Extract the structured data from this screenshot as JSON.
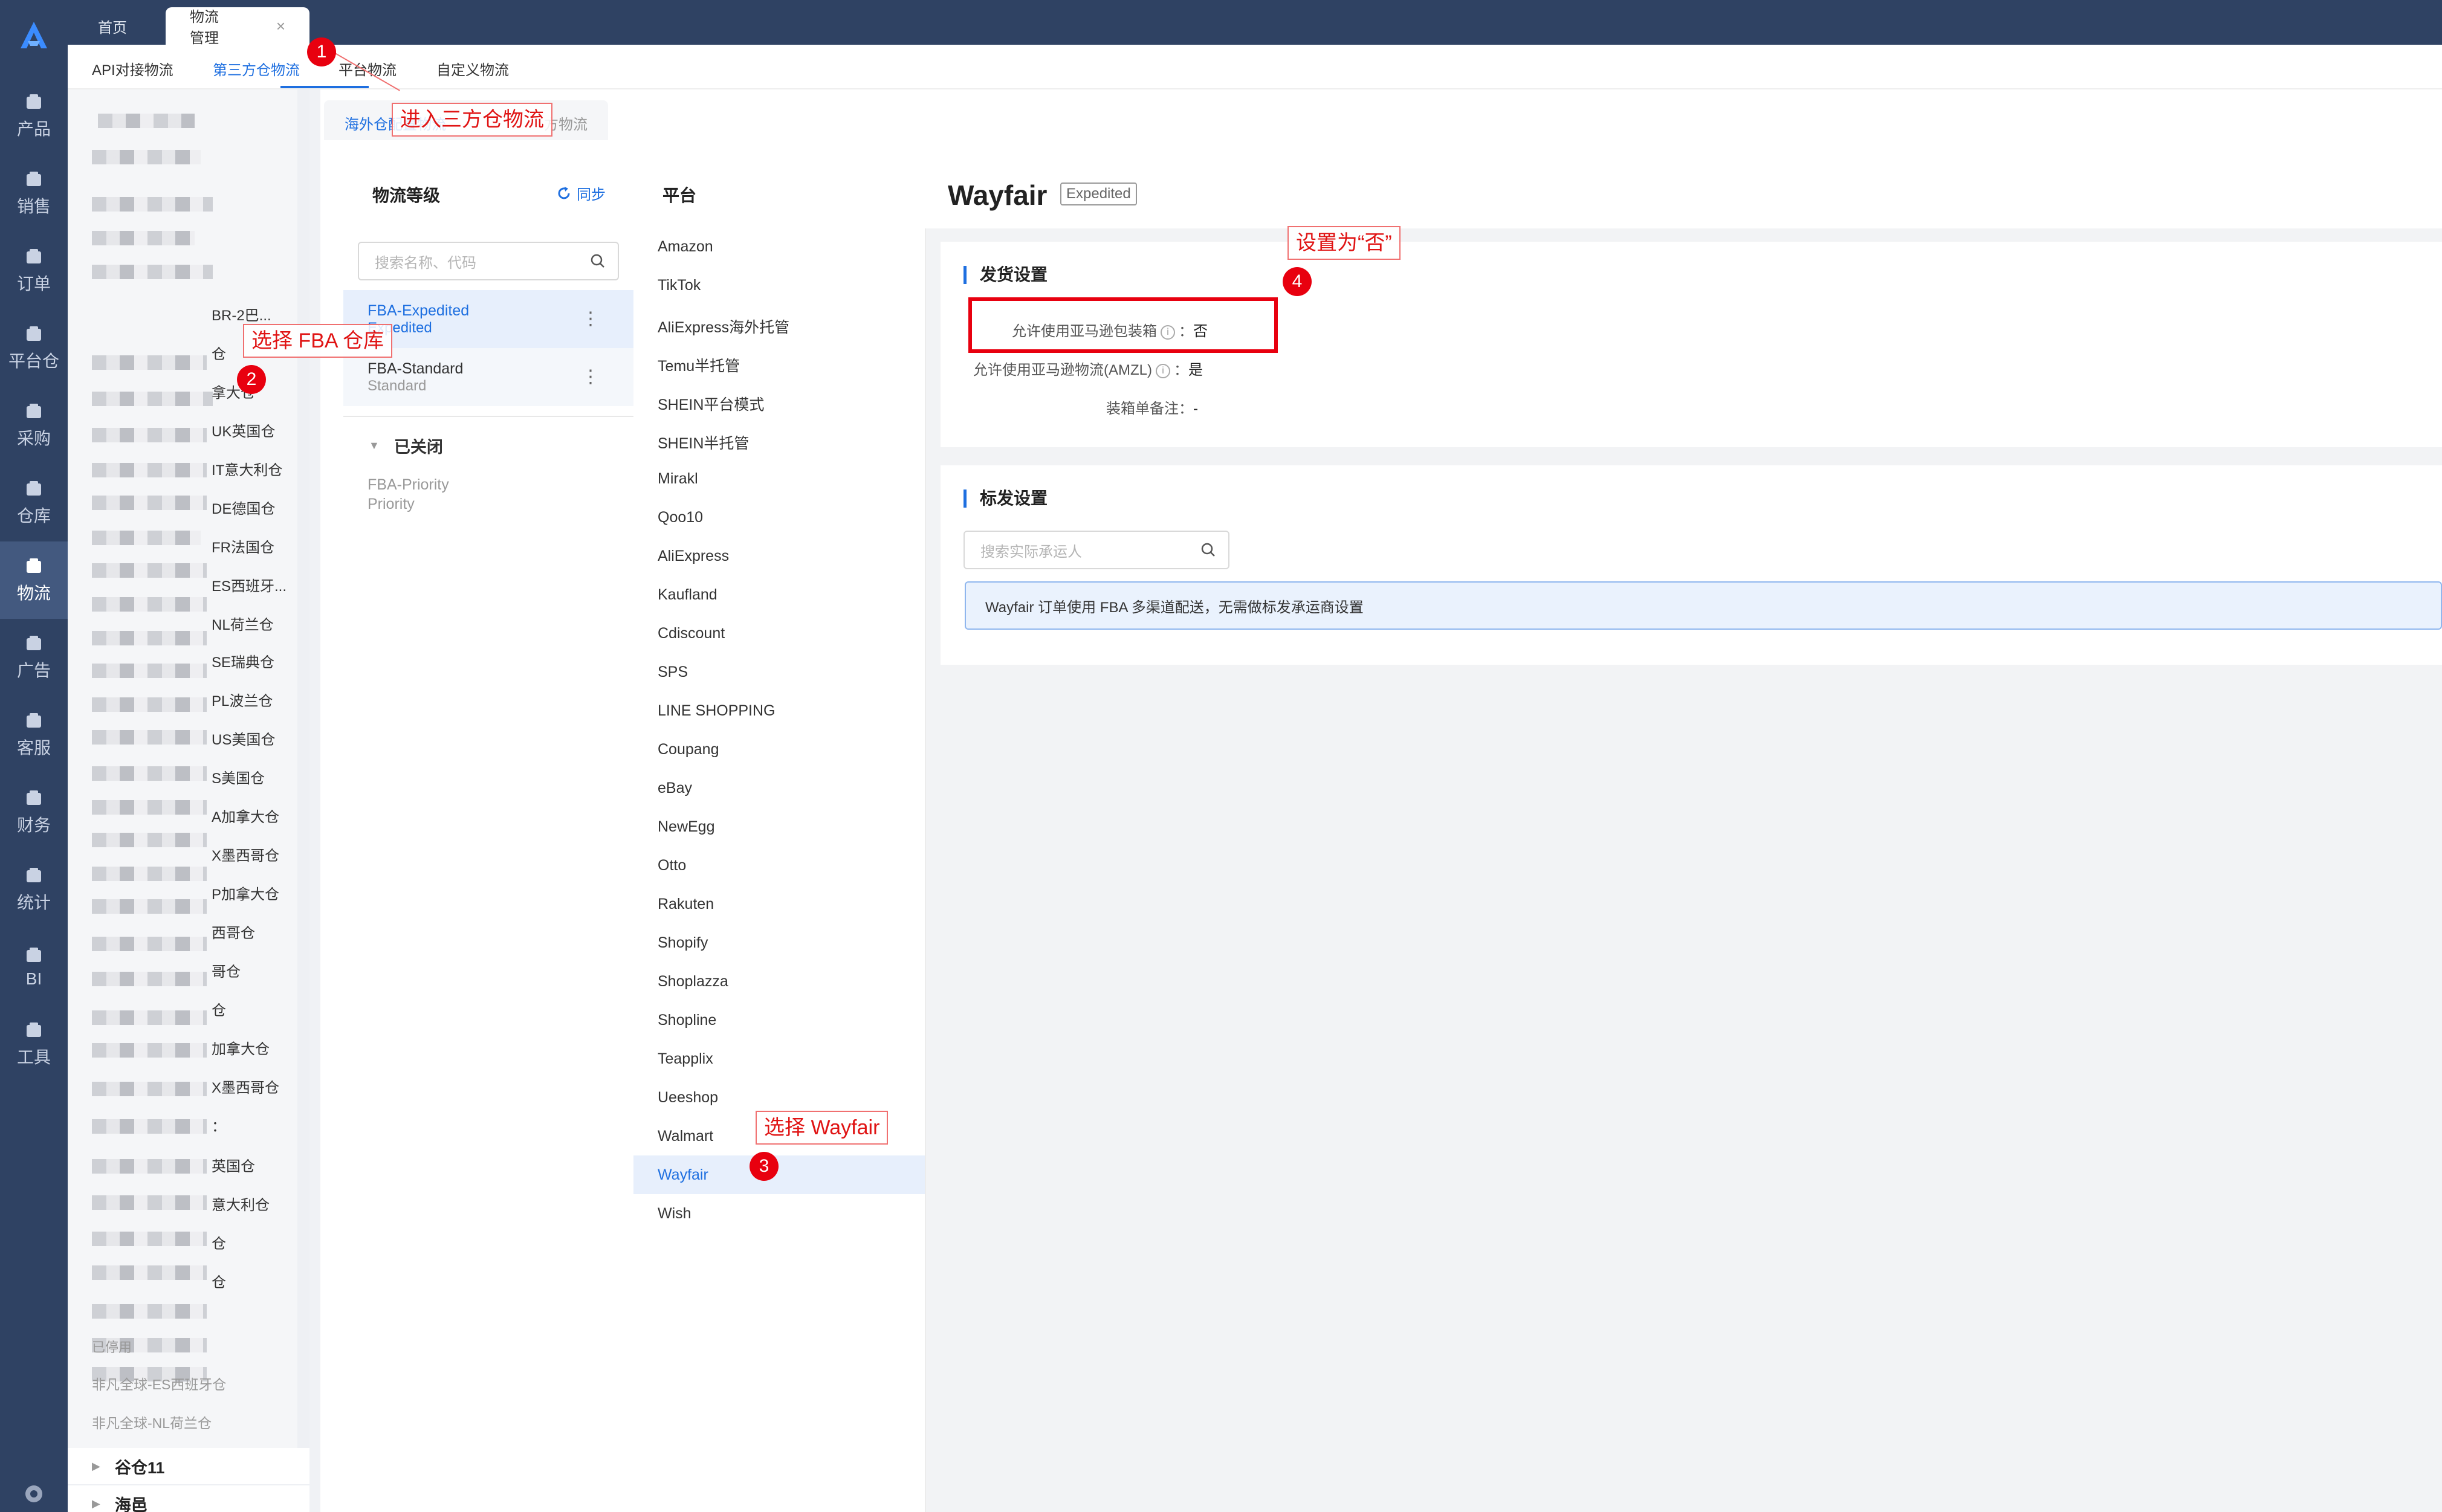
{
  "nav": {
    "items": [
      {
        "label": "产品",
        "icon": "box-icon"
      },
      {
        "label": "销售",
        "icon": "shop-icon"
      },
      {
        "label": "订单",
        "icon": "order-icon"
      },
      {
        "label": "平台仓",
        "icon": "warehouse-icon"
      },
      {
        "label": "采购",
        "icon": "cart-icon"
      },
      {
        "label": "仓库",
        "icon": "store-icon"
      },
      {
        "label": "物流",
        "icon": "truck-icon"
      },
      {
        "label": "广告",
        "icon": "ad-icon"
      },
      {
        "label": "客服",
        "icon": "mail-icon"
      },
      {
        "label": "财务",
        "icon": "yen-icon"
      },
      {
        "label": "统计",
        "icon": "pie-icon"
      },
      {
        "label": "BI",
        "icon": "bi-icon"
      },
      {
        "label": "工具",
        "icon": "wrench-icon"
      }
    ],
    "active_index": 6
  },
  "topbar": {
    "tabs": [
      "首页",
      "物流管理"
    ],
    "close_glyph": "×"
  },
  "subtabs": [
    "API对接物流",
    "第三方仓物流",
    "平台物流",
    "自定义物流"
  ],
  "warehouse_list": {
    "visible_labels": [
      "BR-2巴...",
      "仓",
      "拿大仓",
      "UK英国仓",
      "IT意大利仓",
      "DE德国仓",
      "FR法国仓",
      "ES西班牙...",
      "NL荷兰仓",
      "SE瑞典仓",
      "PL波兰仓",
      "US美国仓",
      "S美国仓",
      "A加拿大仓",
      "X墨西哥仓",
      "P加拿大仓",
      "西哥仓",
      "哥仓",
      "仓",
      "加拿大仓",
      "X墨西哥仓",
      "：",
      "英国仓",
      "意大利仓",
      "仓",
      "仓"
    ],
    "disabled_header": "已停用",
    "disabled_items": [
      "非凡全球-ES西班牙仓",
      "非凡全球-NL荷兰仓"
    ],
    "groups": [
      "谷仓11",
      "海邑"
    ]
  },
  "inner_tabs": [
    "海外仓配置物流",
    "方物流"
  ],
  "levels": {
    "header": "物流等级",
    "sync_label": "同步",
    "search_placeholder": "搜索名称、代码",
    "items": [
      {
        "name": "FBA-Expedited",
        "code": "Expedited"
      },
      {
        "name": "FBA-Standard",
        "code": "Standard"
      }
    ],
    "more_glyph": "⋮",
    "closed_header": "已关闭",
    "closed_items": [
      {
        "name": "FBA-Priority",
        "code": "Priority"
      }
    ]
  },
  "platforms": {
    "header": "平台",
    "items": [
      "Amazon",
      "TikTok",
      "AliExpress海外托管",
      "Temu半托管",
      "SHEIN平台模式",
      "SHEIN半托管",
      "Mirakl",
      "Qoo10",
      "AliExpress",
      "Kaufland",
      "Cdiscount",
      "SPS",
      "LINE SHOPPING",
      "Coupang",
      "eBay",
      "NewEgg",
      "Otto",
      "Rakuten",
      "Shopify",
      "Shoplazza",
      "Shopline",
      "Teapplix",
      "Ueeshop",
      "Walmart",
      "Wayfair",
      "Wish"
    ],
    "selected": "Wayfair"
  },
  "detail": {
    "title": "Wayfair",
    "badge": "Expedited",
    "shipping": {
      "title": "发货设置",
      "rows": [
        {
          "label": "允许使用亚马逊包装箱",
          "value": "否"
        },
        {
          "label": "允许使用亚马逊物流(AMZL)",
          "value": "是"
        },
        {
          "label": "装箱单备注",
          "value": "-"
        }
      ],
      "info_glyph": "i",
      "sep": "："
    },
    "marking": {
      "title": "标发设置",
      "search_placeholder": "搜索实际承运人",
      "notice": "Wayfair 订单使用 FBA 多渠道配送，无需做标发承运商设置"
    }
  },
  "annotations": [
    {
      "num": "1",
      "text": "进入三方仓物流"
    },
    {
      "num": "2",
      "text": "选择 FBA 仓库"
    },
    {
      "num": "3",
      "text": "选择 Wayfair"
    },
    {
      "num": "4",
      "text": "设置为“否”"
    }
  ],
  "colors": {
    "accent": "#1e6fe0",
    "sidebar": "#2f4263",
    "annotation": "#e8000f"
  }
}
